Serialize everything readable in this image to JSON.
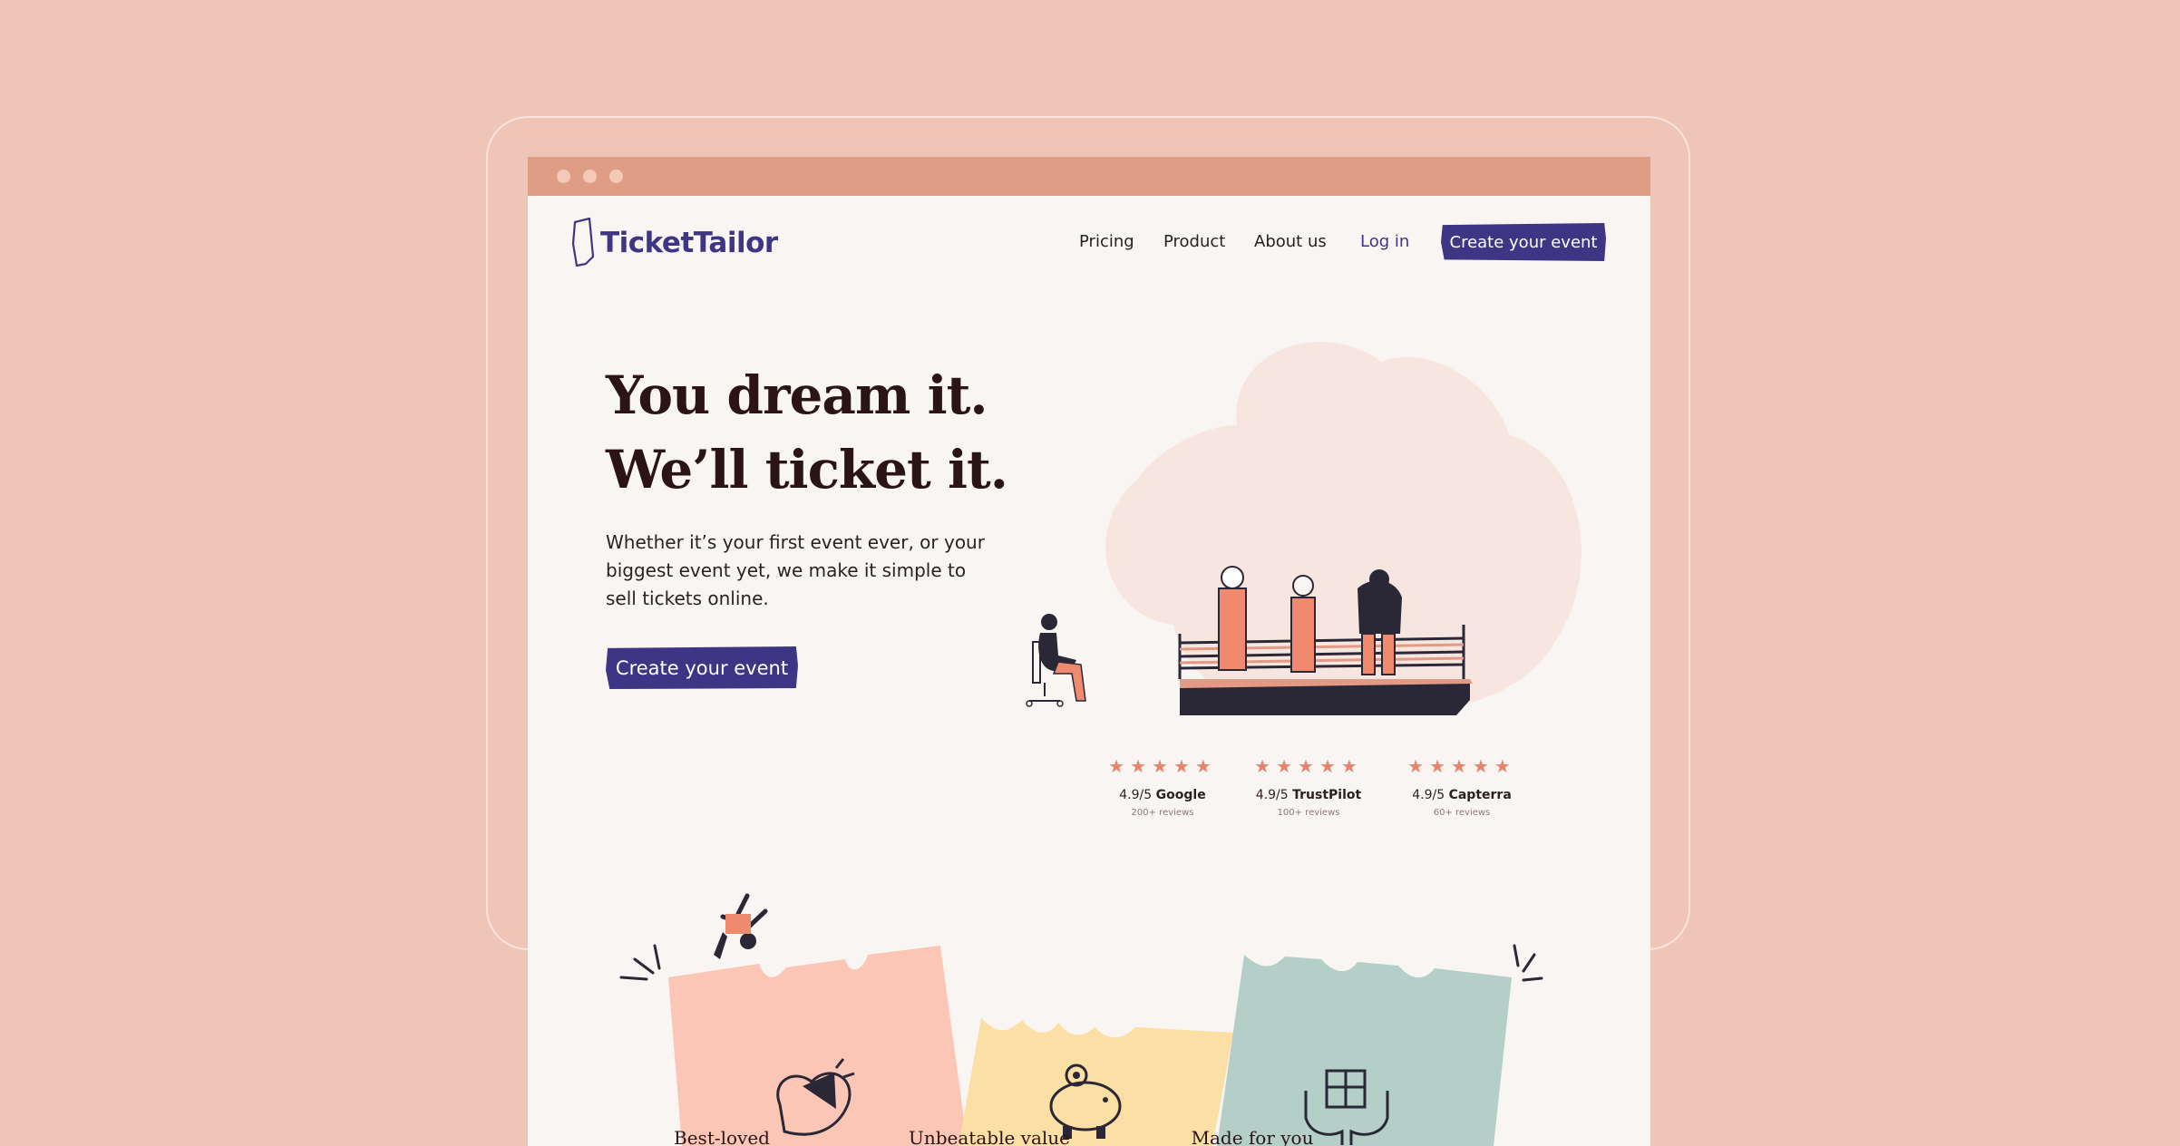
{
  "logo": {
    "text": "TicketTailor"
  },
  "nav": {
    "items": [
      {
        "label": "Pricing"
      },
      {
        "label": "Product"
      },
      {
        "label": "About us"
      }
    ],
    "login": "Log in",
    "cta": "Create your event"
  },
  "hero": {
    "headline_line1": "You dream it.",
    "headline_line2": "We’ll ticket it.",
    "subtext": "Whether it’s your first event ever, or your biggest event yet, we make it simple to sell tickets online.",
    "cta": "Create your event"
  },
  "ratings": [
    {
      "score": "4.9/5",
      "source": "Google",
      "count": "200+ reviews",
      "stars": 5
    },
    {
      "score": "4.9/5",
      "source": "TrustPilot",
      "count": "100+ reviews",
      "stars": 5
    },
    {
      "score": "4.9/5",
      "source": "Capterra",
      "count": "60+ reviews",
      "stars": 5
    }
  ],
  "tickets": [
    {
      "label": "Best-loved",
      "icon": "heart-megaphone-icon",
      "color": "#fcc6b6"
    },
    {
      "label": "Unbeatable value",
      "icon": "piggy-bank-icon",
      "color": "#fcdfa4"
    },
    {
      "label": "Made for you",
      "icon": "gift-hands-icon",
      "color": "#b3cfc8"
    }
  ],
  "colors": {
    "background": "#efc5b8",
    "page": "#f9f5f2",
    "titlebar": "#df9d86",
    "brand": "#3f3585",
    "star": "#e6846a"
  }
}
